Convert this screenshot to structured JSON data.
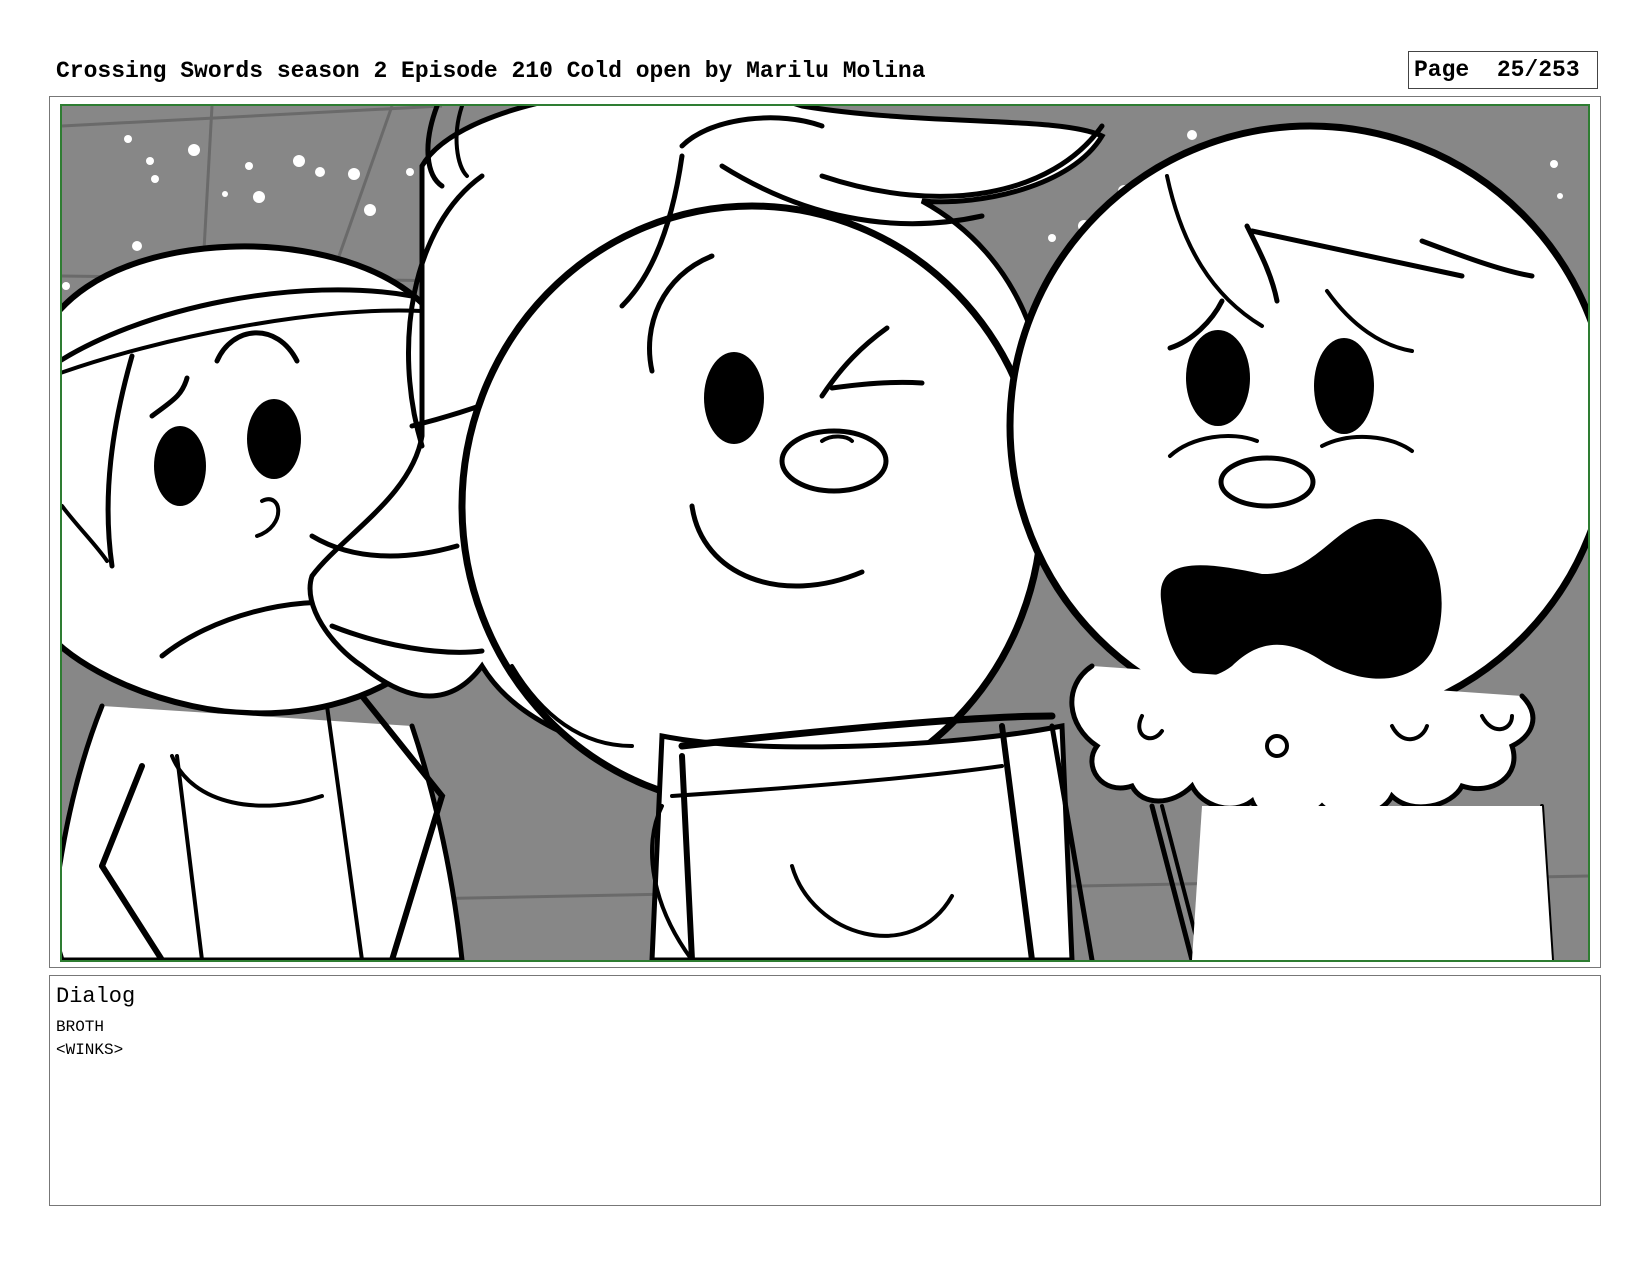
{
  "header": {
    "title": "Crossing Swords season 2 Episode 210 Cold open by Marilu Molina",
    "page_label": "Page  25/253"
  },
  "panel": {
    "frame_color": "#2e7d32",
    "background_color": "#8a8a8a",
    "characters": [
      "left-character",
      "broth",
      "right-character"
    ]
  },
  "dialog": {
    "heading": "Dialog",
    "lines": [
      "BROTH",
      "<WINKS>"
    ]
  }
}
